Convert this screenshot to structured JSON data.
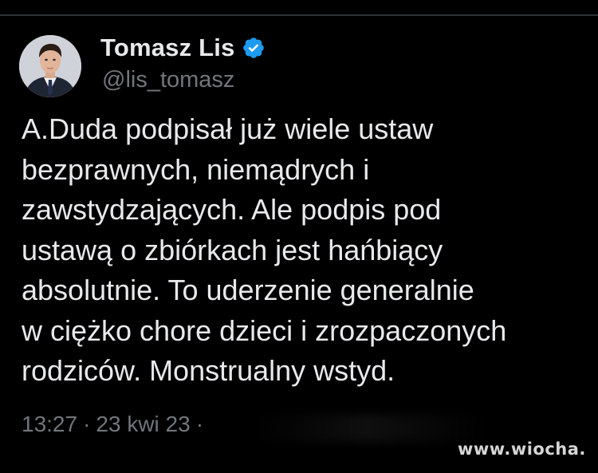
{
  "author": {
    "display_name": "Tomasz Lis",
    "handle": "@lis_tomasz",
    "verified_badge_color": "#1d9bf0",
    "avatar_icon": "profile-photo"
  },
  "post": {
    "text": "A.Duda podpisał już wiele ustaw\nbezprawnych, niemądrych i\nzawstydzających. Ale podpis pod\nustawą o zbiórkach jest hańbiący\nabsolutnie. To uderzenie generalnie\nw ciężko chore dzieci i zrozpaczonych\nrodziców. Monstrualny wstyd.",
    "time": "13:27",
    "date": "23 kwi 23",
    "separator": "·"
  },
  "watermark": {
    "text": "www.wiocha.pl"
  },
  "colors": {
    "background": "#000000",
    "primary_text": "#e7e9ea",
    "secondary_text": "#71767b"
  }
}
